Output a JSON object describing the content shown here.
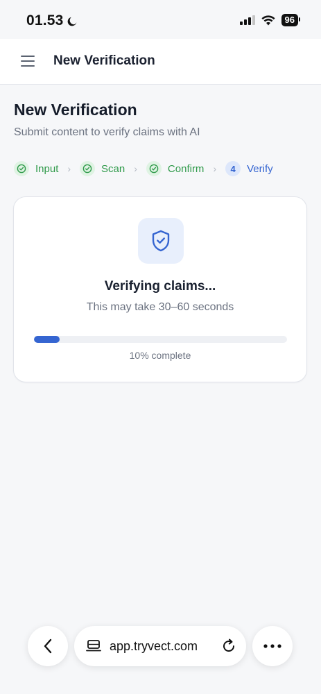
{
  "status_bar": {
    "time": "01.53",
    "battery": "96"
  },
  "header": {
    "title": "New Verification",
    "menu_icon": "menu-icon"
  },
  "page": {
    "title": "New Verification",
    "subtitle": "Submit content to verify claims with AI"
  },
  "stepper": {
    "steps": [
      {
        "label": "Input",
        "state": "done"
      },
      {
        "label": "Scan",
        "state": "done"
      },
      {
        "label": "Confirm",
        "state": "done"
      },
      {
        "number": "4",
        "label": "Verify",
        "state": "active"
      }
    ]
  },
  "card": {
    "icon": "shield-check-icon",
    "title": "Verifying claims...",
    "subtitle": "This may take 30–60 seconds",
    "progress_percent": 10,
    "progress_text": "10% complete"
  },
  "browser": {
    "url": "app.tryvect.com"
  },
  "colors": {
    "accent": "#3565d1",
    "success": "#2f9a4a",
    "background": "#f6f7f9"
  }
}
